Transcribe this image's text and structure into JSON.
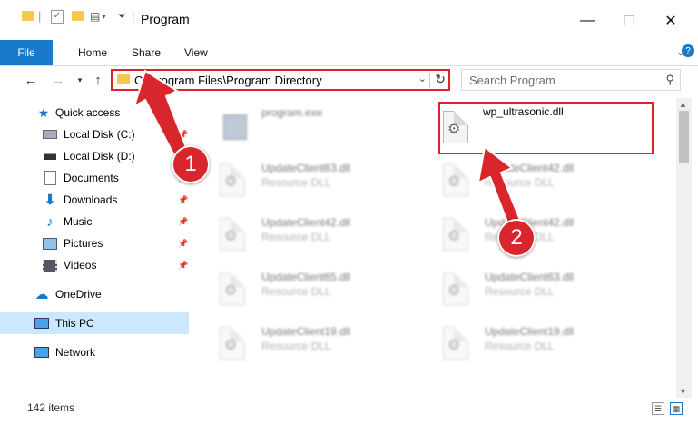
{
  "window": {
    "title": "Program",
    "controls": {
      "minimize": "—",
      "maximize": "☐",
      "close": "✕"
    }
  },
  "ribbon": {
    "tabs": [
      {
        "label": "File"
      },
      {
        "label": "Home"
      },
      {
        "label": "Share"
      },
      {
        "label": "View"
      }
    ]
  },
  "nav": {
    "address_path": "C:\\Program Files\\Program Directory",
    "search_placeholder": "Search Program"
  },
  "sidebar": {
    "items": [
      {
        "label": "Quick access",
        "icon": "star-icon",
        "pinned": false
      },
      {
        "label": "Local Disk (C:)",
        "icon": "drive-icon",
        "pinned": true
      },
      {
        "label": "Local Disk (D:)",
        "icon": "drive-icon",
        "pinned": true
      },
      {
        "label": "Documents",
        "icon": "documents-icon",
        "pinned": true
      },
      {
        "label": "Downloads",
        "icon": "downloads-icon",
        "pinned": true
      },
      {
        "label": "Music",
        "icon": "music-icon",
        "pinned": true
      },
      {
        "label": "Pictures",
        "icon": "pictures-icon",
        "pinned": true
      },
      {
        "label": "Videos",
        "icon": "videos-icon",
        "pinned": true
      },
      {
        "label": "OneDrive",
        "icon": "onedrive-icon",
        "pinned": false
      },
      {
        "label": "This PC",
        "icon": "pc-icon",
        "pinned": false,
        "selected": true
      },
      {
        "label": "Network",
        "icon": "network-icon",
        "pinned": false
      }
    ]
  },
  "files": [
    {
      "name": "program.exe",
      "type": ""
    },
    {
      "name": "wp_ultrasonic.dll",
      "type": ""
    },
    {
      "name": "UpdateClient63.dll",
      "type": "Resource DLL"
    },
    {
      "name": "UpdateClient42.dll",
      "type": "Resource DLL"
    },
    {
      "name": "UpdateClient42.dll",
      "type": "Resource DLL"
    },
    {
      "name": "UpdateClient42.dll",
      "type": "Resource DLL"
    },
    {
      "name": "UpdateClient65.dll",
      "type": "Resource DLL"
    },
    {
      "name": "UpdateClient63.dll",
      "type": "Resource DLL"
    },
    {
      "name": "UpdateClient19.dll",
      "type": "Resource DLL"
    },
    {
      "name": "UpdateClient19.dll",
      "type": "Resource DLL"
    }
  ],
  "status": {
    "item_count": "142 items"
  },
  "annotations": {
    "step1": "1",
    "step2": "2",
    "color": "#d9262c"
  },
  "colors": {
    "accent": "#1979ca",
    "highlight": "#e0202a",
    "selected": "#cce8ff"
  }
}
